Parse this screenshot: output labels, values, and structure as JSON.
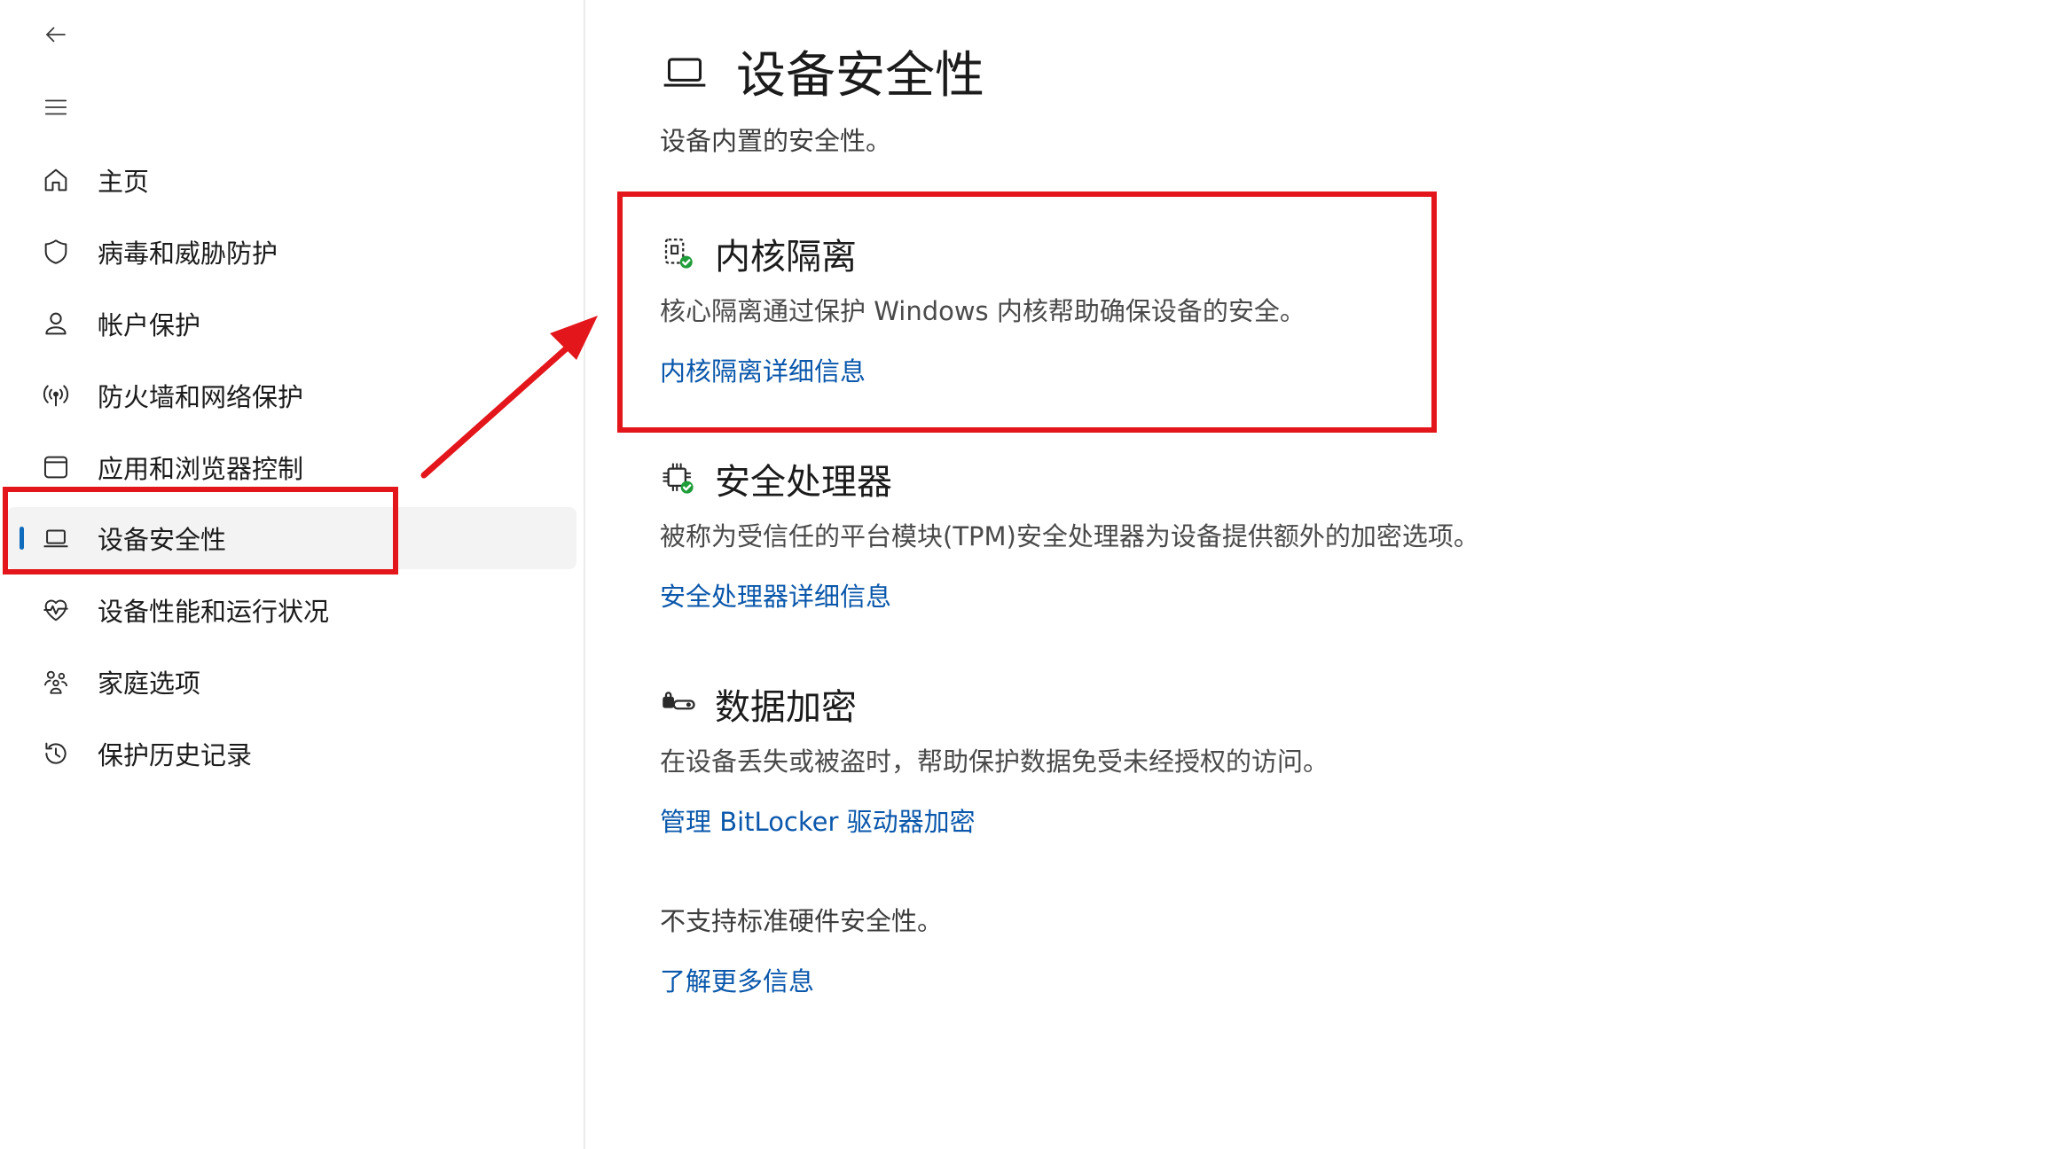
{
  "app": {
    "accent_color": "#0f6cbd",
    "link_color": "#0a57ab",
    "annotation_color": "#e3161b"
  },
  "toolbar": {
    "back_icon": "back-arrow-icon",
    "menu_icon": "hamburger-menu-icon"
  },
  "sidebar": {
    "items": [
      {
        "label": "主页",
        "icon": "home-icon"
      },
      {
        "label": "病毒和威胁防护",
        "icon": "shield-icon"
      },
      {
        "label": "帐户保护",
        "icon": "person-icon"
      },
      {
        "label": "防火墙和网络保护",
        "icon": "wifi-antenna-icon"
      },
      {
        "label": "应用和浏览器控制",
        "icon": "app-window-icon"
      },
      {
        "label": "设备安全性",
        "icon": "laptop-icon",
        "selected": true
      },
      {
        "label": "设备性能和运行状况",
        "icon": "heart-pulse-icon"
      },
      {
        "label": "家庭选项",
        "icon": "family-icon"
      },
      {
        "label": "保护历史记录",
        "icon": "history-icon"
      }
    ]
  },
  "main": {
    "title": "设备安全性",
    "title_icon": "laptop-icon",
    "subtitle": "设备内置的安全性。",
    "sections": [
      {
        "title": "内核隔离",
        "icon": "core-isolation-check-icon",
        "description": "核心隔离通过保护 Windows 内核帮助确保设备的安全。",
        "link": "内核隔离详细信息"
      },
      {
        "title": "安全处理器",
        "icon": "chip-check-icon",
        "description": "被称为受信任的平台模块(TPM)安全处理器为设备提供额外的加密选项。",
        "link": "安全处理器详细信息"
      },
      {
        "title": "数据加密",
        "icon": "drive-lock-icon",
        "description": "在设备丢失或被盗时，帮助保护数据免受未经授权的访问。",
        "link": "管理 BitLocker 驱动器加密"
      }
    ],
    "footer": {
      "text": "不支持标准硬件安全性。",
      "link": "了解更多信息"
    }
  }
}
